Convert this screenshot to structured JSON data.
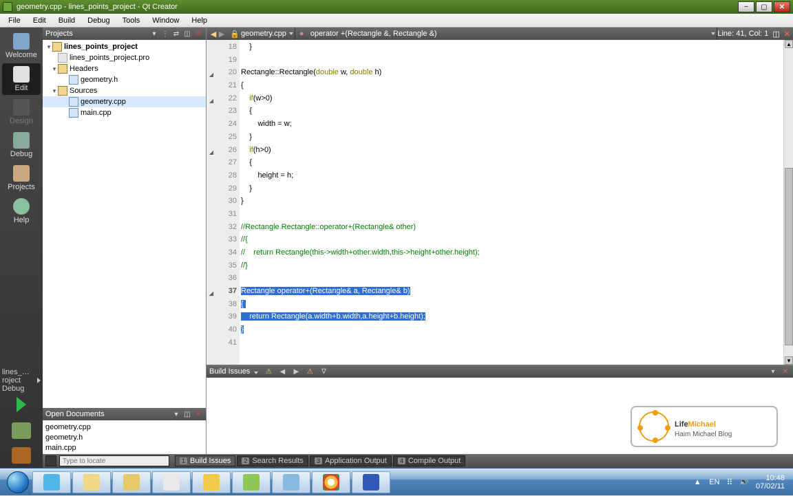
{
  "window": {
    "title": "geometry.cpp - lines_points_project - Qt Creator"
  },
  "menu": {
    "file": "File",
    "edit": "Edit",
    "build": "Build",
    "debug": "Debug",
    "tools": "Tools",
    "window": "Window",
    "help": "Help"
  },
  "modes": {
    "welcome": "Welcome",
    "edit": "Edit",
    "design": "Design",
    "debug": "Debug",
    "projects": "Projects",
    "help": "Help",
    "target": "lines_…roject",
    "target2": "Debug"
  },
  "projectsPanel": {
    "title": "Projects",
    "tree": {
      "root": "lines_points_project",
      "pro": "lines_points_project.pro",
      "headers": "Headers",
      "geometry_h": "geometry.h",
      "sources": "Sources",
      "geometry_cpp": "geometry.cpp",
      "main_cpp": "main.cpp"
    }
  },
  "openDocs": {
    "title": "Open Documents",
    "items": [
      "geometry.cpp",
      "geometry.h",
      "main.cpp"
    ]
  },
  "editorBar": {
    "file": "geometry.cpp",
    "symbol": "operator +(Rectangle &, Rectangle &)",
    "pos": "Line: 41, Col: 1"
  },
  "code": {
    "lines": [
      {
        "n": 18,
        "t": "    }"
      },
      {
        "n": 19,
        "t": ""
      },
      {
        "n": 20,
        "t": "Rectangle::Rectangle($kdouble$/k w, $kdouble$/k h)",
        "fold": true
      },
      {
        "n": 21,
        "t": "{"
      },
      {
        "n": 22,
        "t": "    $kif$/k(w>0)",
        "fold": true
      },
      {
        "n": 23,
        "t": "    {"
      },
      {
        "n": 24,
        "t": "        width = w;"
      },
      {
        "n": 25,
        "t": "    }"
      },
      {
        "n": 26,
        "t": "    $kif$/k(h>0)",
        "fold": true
      },
      {
        "n": 27,
        "t": "    {"
      },
      {
        "n": 28,
        "t": "        height = h;"
      },
      {
        "n": 29,
        "t": "    }"
      },
      {
        "n": 30,
        "t": "}"
      },
      {
        "n": 31,
        "t": ""
      },
      {
        "n": 32,
        "t": "$c//Rectangle Rectangle::operator+(Rectangle& other)$/c"
      },
      {
        "n": 33,
        "t": "$c//{$/c"
      },
      {
        "n": 34,
        "t": "$c//    return Rectangle(this->width+other.width,this->height+other.height);$/c"
      },
      {
        "n": 35,
        "t": "$c//}$/c"
      },
      {
        "n": 36,
        "t": ""
      },
      {
        "n": 37,
        "t": "$sRectangle $koperator$/k+(Rectangle& a, Rectangle& b)$/s",
        "fold": true,
        "cur": true
      },
      {
        "n": 38,
        "t": "$s{ $/s"
      },
      {
        "n": 39,
        "t": "$s    $kreturn$/k Rectangle(a.width+b.width,a.height+b.height);$/s"
      },
      {
        "n": 40,
        "t": "$s}$/s"
      },
      {
        "n": 41,
        "t": ""
      }
    ]
  },
  "buildPanel": {
    "title": "Build Issues"
  },
  "locator": {
    "placeholder": "Type to locate",
    "tabs": [
      "Build Issues",
      "Search Results",
      "Application Output",
      "Compile Output"
    ]
  },
  "logo": {
    "brand1": "Life",
    "brand2": "Michael",
    "tagline": "Haim Michael Blog"
  },
  "taskbar": {
    "lang": "EN",
    "time": "10:48",
    "date": "07/02/11"
  }
}
